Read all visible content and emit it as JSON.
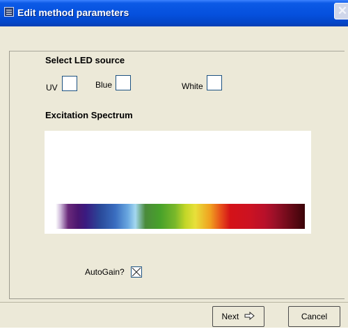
{
  "window": {
    "title": "Edit method parameters",
    "close_glyph": "✕"
  },
  "led_source": {
    "heading": "Select LED source",
    "options": [
      {
        "label": "UV",
        "checked": false
      },
      {
        "label": "Blue",
        "checked": false
      },
      {
        "label": "White",
        "checked": false
      }
    ]
  },
  "spectrum": {
    "heading": "Excitation Spectrum"
  },
  "autogain": {
    "label": "AutoGain?",
    "checked": true
  },
  "buttons": {
    "next_label": "Next",
    "next_icon": "arrow-right-icon",
    "cancel_label": "Cancel"
  },
  "colors": {
    "titlebar": "#0550dd",
    "dialog_bg": "#ece9d8",
    "checkbox_border": "#1c5180"
  }
}
